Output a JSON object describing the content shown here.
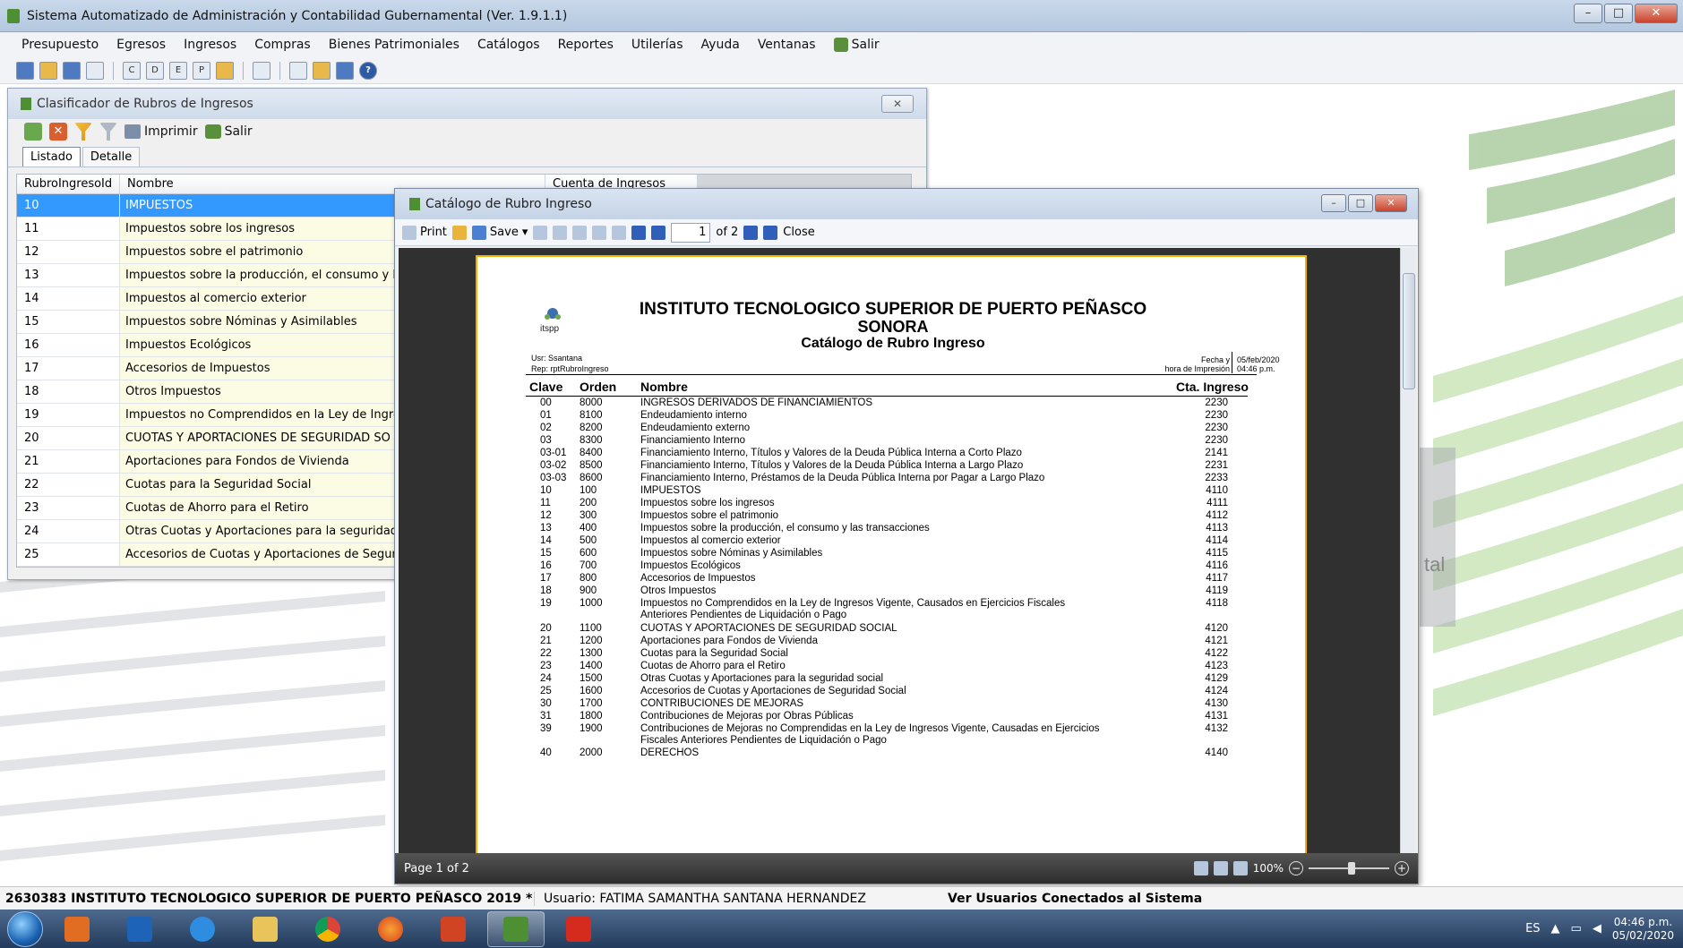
{
  "app": {
    "title": "Sistema Automatizado de Administración y Contabilidad Gubernamental  (Ver. 1.9.1.1)"
  },
  "menu": [
    "Presupuesto",
    "Egresos",
    "Ingresos",
    "Compras",
    "Bienes Patrimoniales",
    "Catálogos",
    "Reportes",
    "Utilerías",
    "Ayuda",
    "Ventanas",
    "Salir"
  ],
  "clasificador": {
    "title": "Clasificador de Rubros de Ingresos",
    "print_label": "Imprimir",
    "exit_label": "Salir",
    "tabs": [
      "Listado",
      "Detalle"
    ],
    "columns": [
      "RubroIngresoId",
      "Nombre",
      "Cuenta de Ingresos"
    ],
    "rows": [
      {
        "id": "10",
        "name": "IMPUESTOS"
      },
      {
        "id": "11",
        "name": "Impuestos sobre los ingresos"
      },
      {
        "id": "12",
        "name": "Impuestos sobre el patrimonio"
      },
      {
        "id": "13",
        "name": "Impuestos sobre la producción, el consumo y las tra"
      },
      {
        "id": "14",
        "name": "Impuestos al comercio exterior"
      },
      {
        "id": "15",
        "name": "Impuestos sobre Nóminas y Asimilables"
      },
      {
        "id": "16",
        "name": "Impuestos Ecológicos"
      },
      {
        "id": "17",
        "name": "Accesorios de Impuestos"
      },
      {
        "id": "18",
        "name": "Otros Impuestos"
      },
      {
        "id": "19",
        "name": "Impuestos no Comprendidos en la Ley de Ingresos V"
      },
      {
        "id": "20",
        "name": "CUOTAS Y APORTACIONES DE SEGURIDAD SO"
      },
      {
        "id": "21",
        "name": "Aportaciones para Fondos de Vivienda"
      },
      {
        "id": "22",
        "name": "Cuotas para la Seguridad Social"
      },
      {
        "id": "23",
        "name": "Cuotas de Ahorro para el Retiro"
      },
      {
        "id": "24",
        "name": "Otras Cuotas y Aportaciones para la seguridad socia"
      },
      {
        "id": "25",
        "name": "Accesorios de Cuotas y Aportaciones de Seguridad"
      }
    ]
  },
  "viewer": {
    "title": "Catálogo de Rubro Ingreso",
    "print_label": "Print",
    "save_label": "Save",
    "page_value": "1",
    "page_of": "of 2",
    "close_label": "Close",
    "status_page": "Page 1 of 2",
    "zoom": "100%"
  },
  "report": {
    "logo_text": "itspp",
    "title_line1": "INSTITUTO TECNOLOGICO SUPERIOR DE PUERTO PEÑASCO",
    "title_line2": "SONORA",
    "title_line3": "Catálogo de Rubro Ingreso",
    "usr": "Usr: Ssantana",
    "rep": "Rep: rptRubroIngreso",
    "fecha_label": "Fecha y",
    "hora_label": "hora de Impresión",
    "fecha": "05/feb/2020",
    "hora": "04:46 p.m.",
    "headers": {
      "clave": "Clave",
      "orden": "Orden",
      "nombre": "Nombre",
      "cuenta": "Cta. Ingreso"
    },
    "rows": [
      {
        "clave": "00",
        "orden": "8000",
        "nombre": "INGRESOS DERIVADOS DE FINANCIAMIENTOS",
        "cuenta": "2230"
      },
      {
        "clave": "01",
        "orden": "8100",
        "nombre": "Endeudamiento interno",
        "cuenta": "2230"
      },
      {
        "clave": "02",
        "orden": "8200",
        "nombre": "Endeudamiento externo",
        "cuenta": "2230"
      },
      {
        "clave": "03",
        "orden": "8300",
        "nombre": "Financiamiento Interno",
        "cuenta": "2230"
      },
      {
        "clave": "03-01",
        "orden": "8400",
        "nombre": "Financiamiento Interno, Títulos y Valores de la Deuda Pública Interna a Corto Plazo",
        "cuenta": "2141"
      },
      {
        "clave": "03-02",
        "orden": "8500",
        "nombre": "Financiamiento Interno, Títulos y Valores de la Deuda Pública Interna a Largo Plazo",
        "cuenta": "2231"
      },
      {
        "clave": "03-03",
        "orden": "8600",
        "nombre": "Financiamiento Interno,  Préstamos de la Deuda Pública Interna por Pagar a Largo Plazo",
        "cuenta": "2233"
      },
      {
        "clave": "10",
        "orden": "100",
        "nombre": "IMPUESTOS",
        "cuenta": "4110"
      },
      {
        "clave": "11",
        "orden": "200",
        "nombre": "Impuestos sobre los ingresos",
        "cuenta": "4111"
      },
      {
        "clave": "12",
        "orden": "300",
        "nombre": "Impuestos sobre el patrimonio",
        "cuenta": "4112"
      },
      {
        "clave": "13",
        "orden": "400",
        "nombre": "Impuestos sobre la producción, el consumo y las transacciones",
        "cuenta": "4113"
      },
      {
        "clave": "14",
        "orden": "500",
        "nombre": "Impuestos al comercio exterior",
        "cuenta": "4114"
      },
      {
        "clave": "15",
        "orden": "600",
        "nombre": "Impuestos sobre Nóminas y Asimilables",
        "cuenta": "4115"
      },
      {
        "clave": "16",
        "orden": "700",
        "nombre": "Impuestos Ecológicos",
        "cuenta": "4116"
      },
      {
        "clave": "17",
        "orden": "800",
        "nombre": "Accesorios de Impuestos",
        "cuenta": "4117"
      },
      {
        "clave": "18",
        "orden": "900",
        "nombre": "Otros Impuestos",
        "cuenta": "4119"
      },
      {
        "clave": "19",
        "orden": "1000",
        "nombre": "Impuestos no Comprendidos en la Ley de Ingresos Vigente, Causados en Ejercicios Fiscales",
        "nombre2": "Anteriores Pendientes de Liquidación o Pago",
        "cuenta": "4118"
      },
      {
        "clave": "20",
        "orden": "1100",
        "nombre": "CUOTAS Y APORTACIONES DE SEGURIDAD SOCIAL",
        "cuenta": "4120"
      },
      {
        "clave": "21",
        "orden": "1200",
        "nombre": "Aportaciones para Fondos de Vivienda",
        "cuenta": "4121"
      },
      {
        "clave": "22",
        "orden": "1300",
        "nombre": "Cuotas para la Seguridad Social",
        "cuenta": "4122"
      },
      {
        "clave": "23",
        "orden": "1400",
        "nombre": "Cuotas de Ahorro para el Retiro",
        "cuenta": "4123"
      },
      {
        "clave": "24",
        "orden": "1500",
        "nombre": "Otras Cuotas y Aportaciones para la seguridad social",
        "cuenta": "4129"
      },
      {
        "clave": "25",
        "orden": "1600",
        "nombre": "Accesorios de Cuotas y Aportaciones de Seguridad Social",
        "cuenta": "4124"
      },
      {
        "clave": "30",
        "orden": "1700",
        "nombre": "CONTRIBUCIONES DE MEJORAS",
        "cuenta": "4130"
      },
      {
        "clave": "31",
        "orden": "1800",
        "nombre": "Contribuciones de Mejoras por Obras Públicas",
        "cuenta": "4131"
      },
      {
        "clave": "39",
        "orden": "1900",
        "nombre": "Contribuciones de Mejoras no Comprendidas en la Ley de Ingresos Vigente, Causadas en Ejercicios",
        "nombre2": "Fiscales Anteriores Pendientes de Liquidación o Pago",
        "cuenta": "4132"
      },
      {
        "clave": "40",
        "orden": "2000",
        "nombre": "DERECHOS",
        "cuenta": "4140"
      }
    ]
  },
  "background": {
    "peek_text": "tal"
  },
  "statusbar": {
    "institution": "2630383 INSTITUTO TECNOLOGICO SUPERIOR DE PUERTO PEÑASCO  2019  *",
    "user": "Usuario: FATIMA SAMANTHA SANTANA HERNANDEZ",
    "connected": "Ver Usuarios Conectados al Sistema"
  },
  "taskbar": {
    "lang": "ES",
    "time": "04:46 p.m.",
    "date": "05/02/2020"
  }
}
